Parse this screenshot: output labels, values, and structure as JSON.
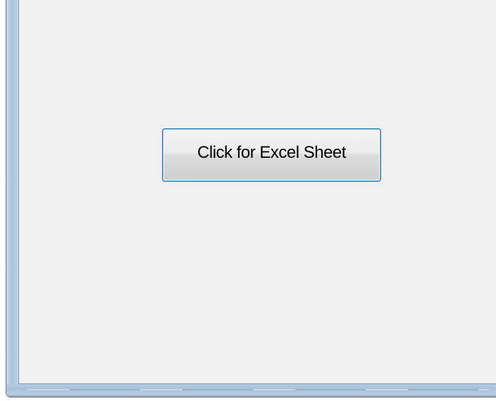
{
  "form": {
    "button": {
      "label": "Click for Excel Sheet"
    }
  },
  "colors": {
    "client_background": "#f0f0f0",
    "frame_glass": "#b6cde3",
    "button_focus_border": "#3c7fb1",
    "button_hover_glow": "#48c8f5"
  }
}
